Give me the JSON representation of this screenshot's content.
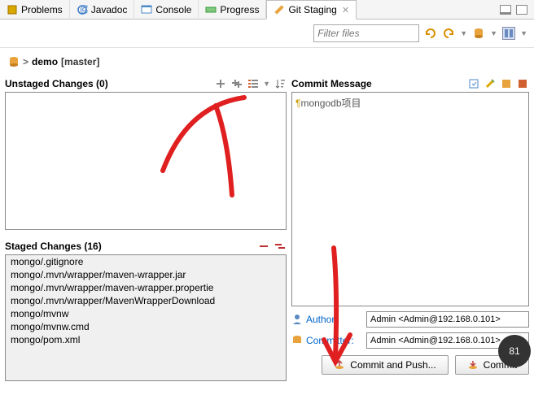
{
  "tabs": {
    "problems": "Problems",
    "javadoc": "Javadoc",
    "console": "Console",
    "progress": "Progress",
    "git_staging": "Git Staging"
  },
  "toolbar": {
    "filter_placeholder": "Filter files"
  },
  "repo": {
    "name": "demo",
    "branch": "[master]"
  },
  "unstaged": {
    "title": "Unstaged Changes",
    "count": "(0)"
  },
  "staged": {
    "title": "Staged Changes",
    "count": "(16)",
    "files": [
      "mongo/.gitignore",
      "mongo/.mvn/wrapper/maven-wrapper.jar",
      "mongo/.mvn/wrapper/maven-wrapper.propertie",
      "mongo/.mvn/wrapper/MavenWrapperDownload",
      "mongo/mvnw",
      "mongo/mvnw.cmd",
      "mongo/pom.xml"
    ]
  },
  "commit": {
    "title": "Commit Message",
    "message": "mongodb项目",
    "author_label": "Author:",
    "author_value": "Admin <Admin@192.168.0.101>",
    "committer_label": "Committer:",
    "committer_value": "Admin <Admin@192.168.0.101>",
    "commit_push_btn": "Commit and Push...",
    "commit_btn": "Commit"
  },
  "badge": "81"
}
